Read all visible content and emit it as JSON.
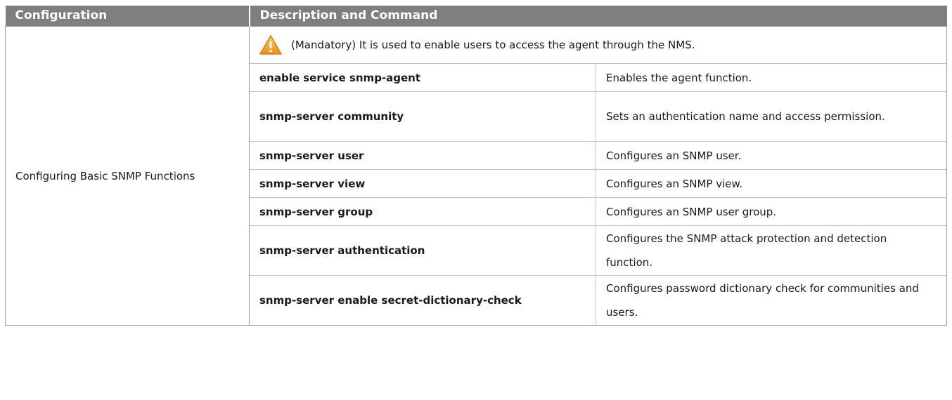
{
  "table": {
    "headers": [
      "Configuration",
      "Description and Command"
    ],
    "config_label": "Configuring Basic SNMP Functions",
    "note_icon": "warning-icon",
    "note_text": "(Mandatory) It is used to enable users to access the agent through the NMS.",
    "accent_colors": {
      "header_bg": "#7f7f7f",
      "warning_icon": "#f5a623"
    },
    "rows": [
      {
        "command": "enable service snmp-agent",
        "description": "Enables the agent function."
      },
      {
        "command": "snmp-server community",
        "description": "Sets an authentication name and access permission."
      },
      {
        "command": "snmp-server user",
        "description": "Configures an SNMP user."
      },
      {
        "command": "snmp-server view",
        "description": "Configures an SNMP view."
      },
      {
        "command": "snmp-server group",
        "description": "Configures an SNMP user group."
      },
      {
        "command": "snmp-server authentication",
        "description": "Configures the SNMP attack protection and detection function."
      },
      {
        "command": "snmp-server enable secret-dictionary-check",
        "description": "Configures password dictionary check for communities and users."
      }
    ]
  }
}
